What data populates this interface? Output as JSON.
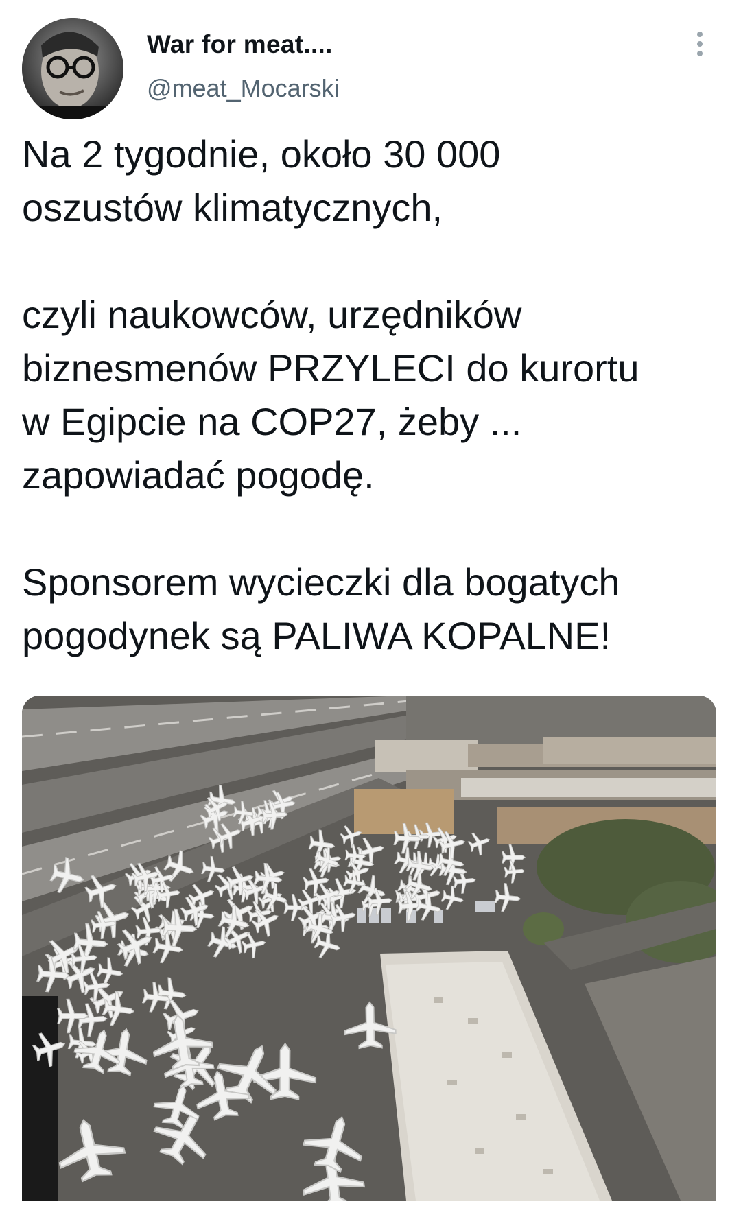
{
  "tweet": {
    "author_name": "War for meat....",
    "author_handle": "@meat_Mocarski",
    "avatar_icon": "profile-photo-avatar",
    "more_icon": "more-vertical-icon",
    "text_lines": [
      "Na 2 tygodnie, około 30 000",
      "oszustów klimatycznych,",
      "",
      "czyli naukowców, urzędników",
      "biznesmenów PRZYLECI do kurortu",
      "w Egipcie na COP27, żeby ...",
      "zapowiadać pogodę.",
      "",
      "Sponsorem wycieczki dla bogatych",
      "pogodynek są PALIWA KOPALNE!"
    ],
    "media": {
      "kind": "photo",
      "colors": {
        "tarmac": "#5e5c58",
        "runway": "#8a8884",
        "roof": "#d8d4cc",
        "building": "#b59a7a",
        "trees": "#4b5a3a",
        "plane": "#f2f2f2"
      }
    }
  }
}
